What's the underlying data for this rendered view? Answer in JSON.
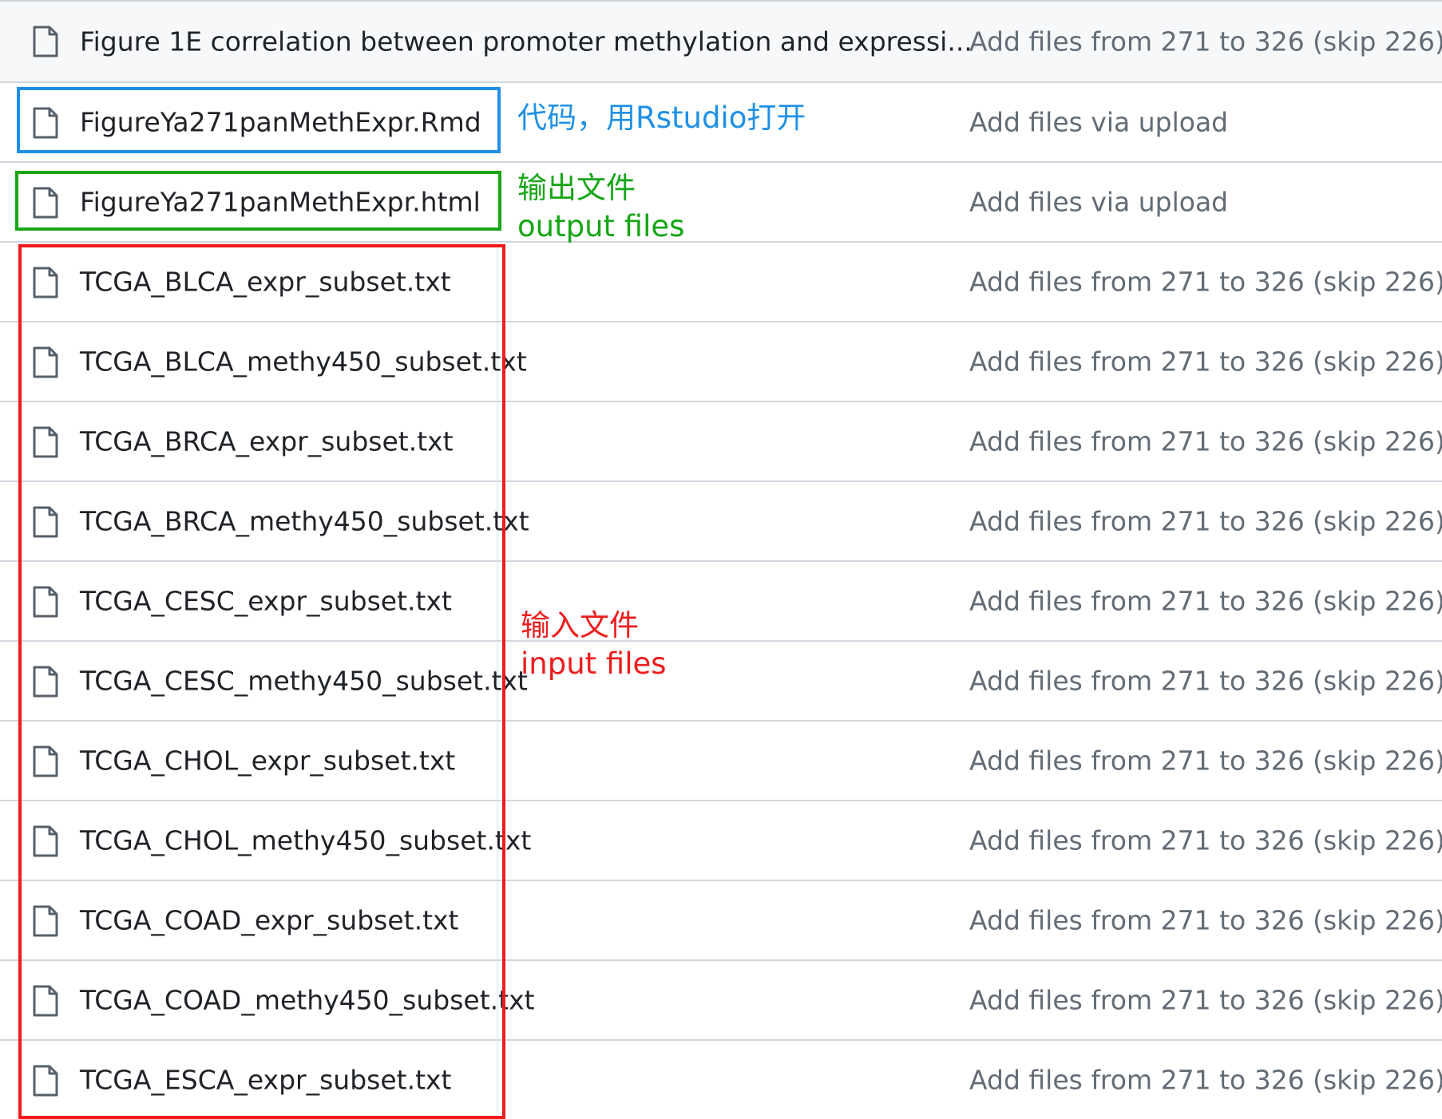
{
  "files": [
    {
      "icon": "file-icon",
      "name": "Figure 1E correlation between promoter methylation and expressi...",
      "commit": "Add files from 271 to 326 (skip 226)"
    },
    {
      "icon": "file-icon",
      "name": "FigureYa271panMethExpr.Rmd",
      "commit": "Add files via upload"
    },
    {
      "icon": "file-icon",
      "name": "FigureYa271panMethExpr.html",
      "commit": "Add files via upload"
    },
    {
      "icon": "file-icon",
      "name": "TCGA_BLCA_expr_subset.txt",
      "commit": "Add files from 271 to 326 (skip 226)"
    },
    {
      "icon": "file-icon",
      "name": "TCGA_BLCA_methy450_subset.txt",
      "commit": "Add files from 271 to 326 (skip 226)"
    },
    {
      "icon": "file-icon",
      "name": "TCGA_BRCA_expr_subset.txt",
      "commit": "Add files from 271 to 326 (skip 226)"
    },
    {
      "icon": "file-icon",
      "name": "TCGA_BRCA_methy450_subset.txt",
      "commit": "Add files from 271 to 326 (skip 226)"
    },
    {
      "icon": "file-icon",
      "name": "TCGA_CESC_expr_subset.txt",
      "commit": "Add files from 271 to 326 (skip 226)"
    },
    {
      "icon": "file-icon",
      "name": "TCGA_CESC_methy450_subset.txt",
      "commit": "Add files from 271 to 326 (skip 226)"
    },
    {
      "icon": "file-icon",
      "name": "TCGA_CHOL_expr_subset.txt",
      "commit": "Add files from 271 to 326 (skip 226)"
    },
    {
      "icon": "file-icon",
      "name": "TCGA_CHOL_methy450_subset.txt",
      "commit": "Add files from 271 to 326 (skip 226)"
    },
    {
      "icon": "file-icon",
      "name": "TCGA_COAD_expr_subset.txt",
      "commit": "Add files from 271 to 326 (skip 226)"
    },
    {
      "icon": "file-icon",
      "name": "TCGA_COAD_methy450_subset.txt",
      "commit": "Add files from 271 to 326 (skip 226)"
    },
    {
      "icon": "file-icon",
      "name": "TCGA_ESCA_expr_subset.txt",
      "commit": "Add files from 271 to 326 (skip 226)"
    }
  ],
  "annotations": {
    "code": {
      "text": "代码，用Rstudio打开",
      "color": "#1e90e6"
    },
    "output": {
      "line1": "输出文件",
      "line2": "output files",
      "color": "#16a616"
    },
    "input": {
      "line1": "输入文件",
      "line2": "input files",
      "color": "#ee1c1c"
    }
  },
  "colors": {
    "row_border": "#d0d7de",
    "first_row_bg": "#f6f8fa",
    "file_name": "#1f2328",
    "commit_msg": "#636c76",
    "icon": "#57606a",
    "code_box": "#1e90e6",
    "output_box": "#16a616",
    "input_box": "#ee1c1c"
  }
}
